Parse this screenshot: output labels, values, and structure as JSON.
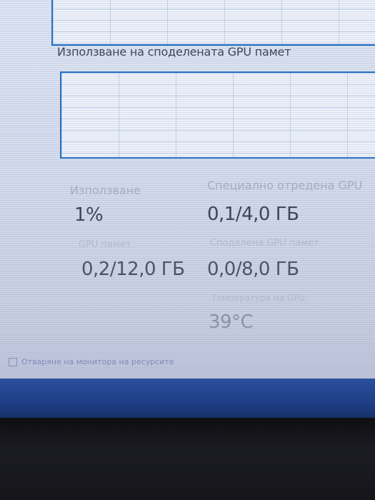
{
  "sections": {
    "shared_gpu_memory_title": "Използване на споделената GPU памет"
  },
  "stats": {
    "utilization": {
      "label": "Използване",
      "value": "1%"
    },
    "dedicated_gpu_memory": {
      "label": "Специално отредена GPU",
      "value": "0,1/4,0 ГБ"
    },
    "gpu_memory": {
      "label": "GPU памет",
      "value": "0,2/12,0 ГБ"
    },
    "shared_gpu_memory": {
      "label": "Споделена GPU памет",
      "value": "0,0/8,0 ГБ"
    },
    "gpu_temperature": {
      "label": "Температура на GPU",
      "value": "39°C"
    }
  },
  "footer": {
    "link_text": "Отваряне на монитора на ресурсите"
  },
  "colors": {
    "graph_border": "#1f6fc4",
    "taskbar": "#2b4f9c"
  }
}
